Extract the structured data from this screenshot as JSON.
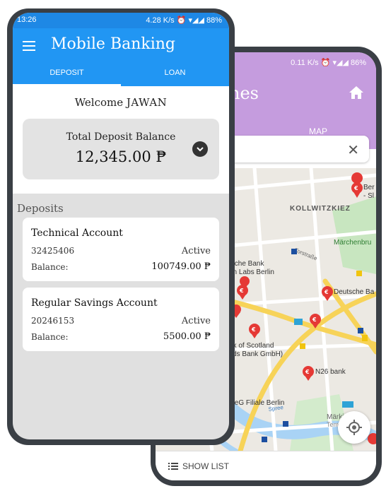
{
  "back_phone": {
    "status": "0.11 K/s ⏰ ▾◢◢ 86%",
    "title": "nes",
    "tab_map": "MAP",
    "show_list": "SHOW LIST",
    "map_labels": {
      "kollwitzkiez": "KOLLWITZKIEZ",
      "marchenbru": "Märchenbru",
      "torstrasse": "Torstraße",
      "deutsche_bank_left": "tsche Bank",
      "deutsche_bank_left2": "on Labs Berlin",
      "deutsche_bank_right": "Deutsche Ba",
      "bank_of_scotland": "nk of Scotland",
      "bank_of_scotland2": "yds Bank GmbH)",
      "n26": "N26 bank",
      "eg_filiale": "k eG Filiale Berlin",
      "spree": "Spree",
      "markisch": "Märkisch",
      "temporar": "Temporar",
      "ber": "Ber",
      "sl": "- Sl"
    }
  },
  "front_phone": {
    "status_time": "13:26",
    "status_right": "4.28 K/s ⏰ ▾◢◢ 88%",
    "app_title": "Mobile Banking",
    "tabs": [
      "DEPOSIT",
      "LOAN"
    ],
    "welcome_prefix": "Welcome",
    "user_name": "JAWAN",
    "total_label": "Total Deposit Balance",
    "total_amount": "12,345.00 ₱",
    "deposits_header": "Deposits",
    "accounts": [
      {
        "name": "Technical Account",
        "number": "32425406",
        "status": "Active",
        "balance_label": "Balance:",
        "balance": "100749.00 ₱"
      },
      {
        "name": "Regular Savings Account",
        "number": "20246153",
        "status": "Active",
        "balance_label": "Balance:",
        "balance": "5500.00 ₱"
      }
    ]
  }
}
